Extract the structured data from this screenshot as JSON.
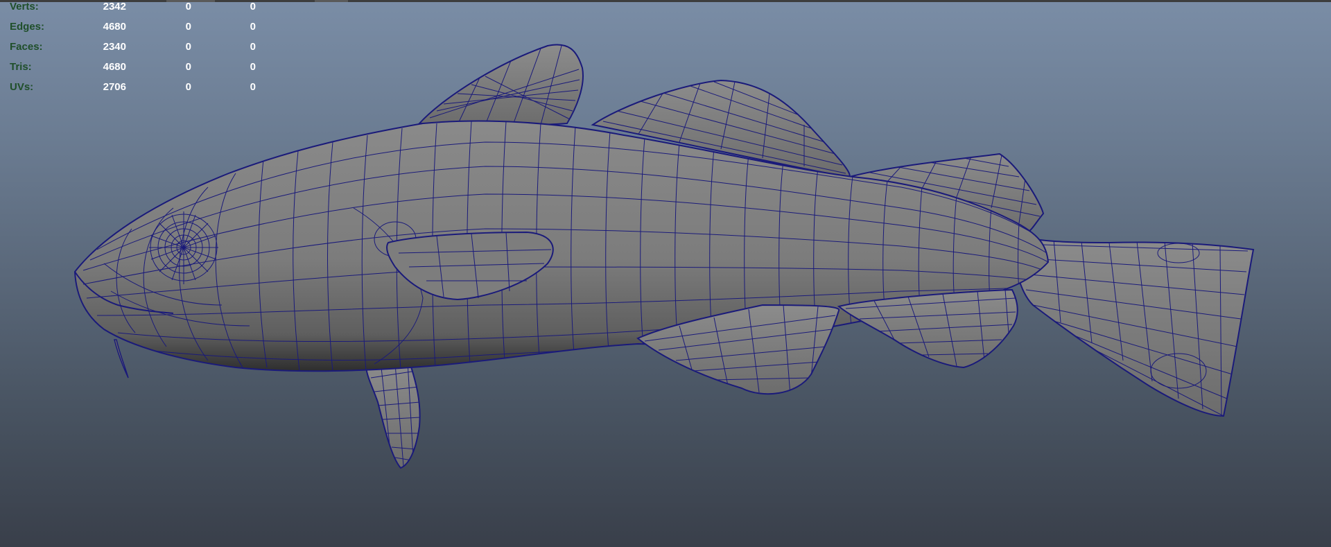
{
  "hud": {
    "rows": [
      {
        "label": "Verts:",
        "values": [
          "2342",
          "0",
          "0"
        ]
      },
      {
        "label": "Edges:",
        "values": [
          "4680",
          "0",
          "0"
        ]
      },
      {
        "label": "Faces:",
        "values": [
          "2340",
          "0",
          "0"
        ]
      },
      {
        "label": "Tris:",
        "values": [
          "4680",
          "0",
          "0"
        ]
      },
      {
        "label": "UVs:",
        "values": [
          "2706",
          "0",
          "0"
        ]
      }
    ]
  },
  "colors": {
    "background_top": "#7a8da6",
    "background_bottom": "#393f4a",
    "hud_label": "#1f4f2a",
    "hud_value": "#ffffff",
    "mesh_fill": "#7b7b7b",
    "wireframe": "#1a1a7a"
  }
}
